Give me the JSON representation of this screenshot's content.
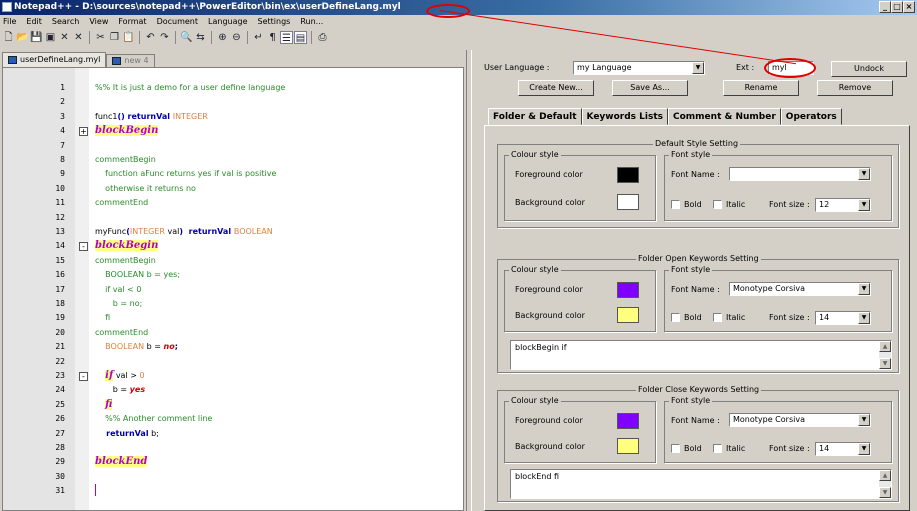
{
  "window": {
    "title": "Notepad++ - D:\\sources\\notepad++\\PowerEditor\\bin\\ex\\userDefineLang.myl",
    "controls": [
      "_",
      "□",
      "×"
    ]
  },
  "menu": [
    "File",
    "Edit",
    "Search",
    "View",
    "Format",
    "Document",
    "Language",
    "Settings",
    "Run..."
  ],
  "toolbar_icons": [
    "new-file",
    "open",
    "save",
    "save-all",
    "close",
    "close-all",
    "cut",
    "copy",
    "paste",
    "undo",
    "redo",
    "find",
    "replace",
    "zoom-in",
    "zoom-out",
    "wrap",
    "show-all",
    "indent-guide",
    "user-define",
    "print"
  ],
  "editor": {
    "tabs": [
      {
        "label": "userDefineLang.myl",
        "active": true
      },
      {
        "label": "new 4",
        "active": false
      }
    ],
    "lines": [
      {
        "n": "1",
        "segs": [
          {
            "c": "cmt",
            "t": "%% It is just a demo for a user define language"
          }
        ]
      },
      {
        "n": "2",
        "segs": []
      },
      {
        "n": "3",
        "segs": [
          {
            "c": "",
            "t": "func1"
          },
          {
            "c": "kw",
            "t": "() returnVal "
          },
          {
            "c": "ty",
            "t": "INTEGER"
          }
        ]
      },
      {
        "n": "4",
        "fold": "+",
        "segs": [
          {
            "c": "blk",
            "t": "blockBegin"
          }
        ]
      },
      {
        "n": "7",
        "segs": []
      },
      {
        "n": "8",
        "segs": [
          {
            "c": "cmt",
            "t": "commentBegin"
          }
        ]
      },
      {
        "n": "9",
        "segs": [
          {
            "c": "cmt",
            "t": "    function aFunc returns yes if val is positive"
          }
        ]
      },
      {
        "n": "10",
        "segs": [
          {
            "c": "cmt",
            "t": "    otherwise it returns no"
          }
        ]
      },
      {
        "n": "11",
        "segs": [
          {
            "c": "cmt",
            "t": "commentEnd"
          }
        ]
      },
      {
        "n": "12",
        "segs": []
      },
      {
        "n": "13",
        "segs": [
          {
            "c": "",
            "t": "myFunc"
          },
          {
            "c": "kw",
            "t": "("
          },
          {
            "c": "ty",
            "t": "INTEGER"
          },
          {
            "c": "",
            "t": " val"
          },
          {
            "c": "kw",
            "t": ")  returnVal "
          },
          {
            "c": "ty",
            "t": "BOOLEAN"
          }
        ]
      },
      {
        "n": "14",
        "fold": "-",
        "segs": [
          {
            "c": "blk",
            "t": "blockBegin"
          }
        ]
      },
      {
        "n": "15",
        "segs": [
          {
            "c": "cmt",
            "t": "commentBegin"
          }
        ]
      },
      {
        "n": "16",
        "segs": [
          {
            "c": "cmt",
            "t": "    BOOLEAN b = yes;"
          }
        ]
      },
      {
        "n": "17",
        "segs": [
          {
            "c": "cmt",
            "t": "    if val < 0"
          }
        ]
      },
      {
        "n": "18",
        "segs": [
          {
            "c": "cmt",
            "t": "       b = no;"
          }
        ]
      },
      {
        "n": "19",
        "segs": [
          {
            "c": "cmt",
            "t": "    fi"
          }
        ]
      },
      {
        "n": "20",
        "segs": [
          {
            "c": "cmt",
            "t": "commentEnd"
          }
        ]
      },
      {
        "n": "21",
        "segs": [
          {
            "c": "ty",
            "t": "    BOOLEAN"
          },
          {
            "c": "",
            "t": " b = "
          },
          {
            "c": "red",
            "t": "no"
          },
          {
            "c": "kw",
            "t": ";"
          }
        ]
      },
      {
        "n": "22",
        "segs": []
      },
      {
        "n": "23",
        "fold": "-",
        "segs": [
          {
            "c": "",
            "t": "    "
          },
          {
            "c": "ifk",
            "t": "if"
          },
          {
            "c": "",
            "t": " val > "
          },
          {
            "c": "num",
            "t": "0"
          }
        ]
      },
      {
        "n": "24",
        "segs": [
          {
            "c": "",
            "t": "       b = "
          },
          {
            "c": "red",
            "t": "yes"
          }
        ]
      },
      {
        "n": "25",
        "segs": [
          {
            "c": "",
            "t": "    "
          },
          {
            "c": "ifk",
            "t": "fi"
          }
        ]
      },
      {
        "n": "26",
        "segs": [
          {
            "c": "cmt",
            "t": "    %% Another comment line"
          }
        ]
      },
      {
        "n": "27",
        "segs": [
          {
            "c": "kw",
            "t": "    returnVal"
          },
          {
            "c": "",
            "t": " b;"
          }
        ]
      },
      {
        "n": "28",
        "segs": []
      },
      {
        "n": "29",
        "segs": [
          {
            "c": "blk",
            "t": "blockEnd"
          }
        ]
      },
      {
        "n": "30",
        "segs": []
      },
      {
        "n": "31",
        "segs": []
      }
    ]
  },
  "udl": {
    "user_language_label": "User Language :",
    "user_language_value": "my Language",
    "ext_label": "Ext :",
    "ext_value": "myl",
    "undock": "Undock",
    "create_new": "Create New...",
    "save_as": "Save As...",
    "rename": "Rename",
    "remove": "Remove",
    "tabs": [
      "Folder & Default",
      "Keywords Lists",
      "Comment & Number",
      "Operators"
    ],
    "sections": [
      {
        "title": "Default Style Setting",
        "fg": "#000000",
        "bg": "#ffffff",
        "font_name": "",
        "font_size": "12",
        "keywords": null
      },
      {
        "title": "Folder Open Keywords Setting",
        "fg": "#8000ff",
        "bg": "#ffff80",
        "font_name": "Monotype Corsiva",
        "font_size": "14",
        "keywords": "blockBegin if"
      },
      {
        "title": "Folder Close Keywords Setting",
        "fg": "#8000ff",
        "bg": "#ffff80",
        "font_name": "Monotype Corsiva",
        "font_size": "14",
        "keywords": "blockEnd fi"
      }
    ],
    "colour_style": "Colour style",
    "font_style": "Font style",
    "fg_label": "Foreground color",
    "bg_label": "Background color",
    "font_name_label": "Font Name :",
    "bold": "Bold",
    "italic": "Italic",
    "font_size_label": "Font size :"
  }
}
